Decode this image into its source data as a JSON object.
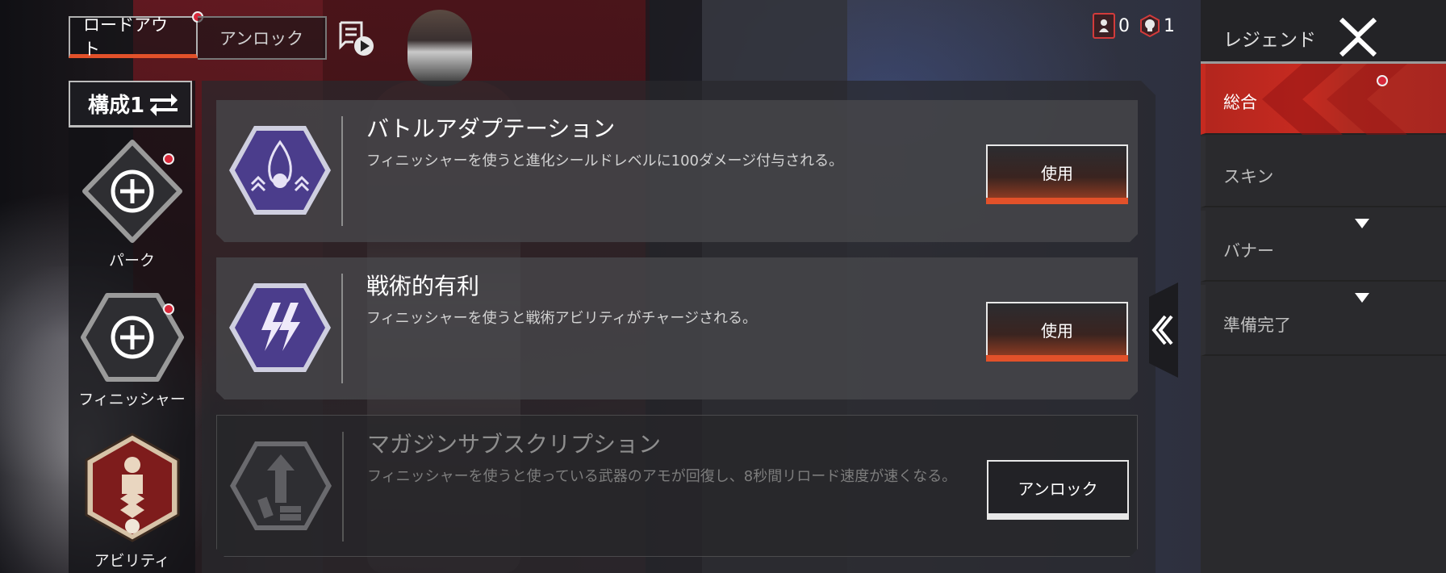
{
  "tabs": [
    {
      "label": "ロードアウト",
      "active": true,
      "notification": true
    },
    {
      "label": "アンロック",
      "active": false,
      "notification": false
    }
  ],
  "header": {
    "replay_icon": "playlist-play-icon",
    "counters": [
      {
        "icon": "legend-token-icon",
        "value": "0"
      },
      {
        "icon": "skull-badge-icon",
        "value": "1"
      }
    ]
  },
  "loadout": {
    "name": "構成1",
    "swap_icon": "swap-arrows-icon",
    "slots": [
      {
        "label": "パーク",
        "icon": "add-icon",
        "notification": true
      },
      {
        "label": "フィニッシャー",
        "icon": "add-icon",
        "notification": true
      },
      {
        "label": "アビリティ",
        "icon": "ability-badge-icon",
        "notification": false
      }
    ]
  },
  "perks": [
    {
      "title": "バトルアダプテーション",
      "description": "フィニッシャーを使うと進化シールドレベルに100ダメージ付与される。",
      "button": "使用",
      "locked": false,
      "icon": "battle-adaptation-icon"
    },
    {
      "title": "戦術的有利",
      "description": "フィニッシャーを使うと戦術アビリティがチャージされる。",
      "button": "使用",
      "locked": false,
      "icon": "tactical-advantage-icon"
    },
    {
      "title": "マガジンサブスクリプション",
      "description": "フィニッシャーを使うと使っている武器のアモが回復し、8秒間リロード速度が速くなる。",
      "button": "アンロック",
      "locked": true,
      "icon": "magazine-subscription-icon"
    }
  ],
  "sidebar": {
    "title": "レジェンド",
    "close_icon": "close-x-icon",
    "items": [
      {
        "label": "総合",
        "active": true,
        "notification": true
      },
      {
        "label": "スキン",
        "active": false,
        "notification": false
      },
      {
        "label": "バナー",
        "active": false,
        "notification": false,
        "chevron": true
      },
      {
        "label": "準備完了",
        "active": false,
        "notification": false,
        "chevron": true
      }
    ]
  },
  "colors": {
    "accent": "#e2512a",
    "active_red": "#c62a20",
    "notification_red": "#d8283a",
    "perk_purple": "#5b4a9e"
  }
}
